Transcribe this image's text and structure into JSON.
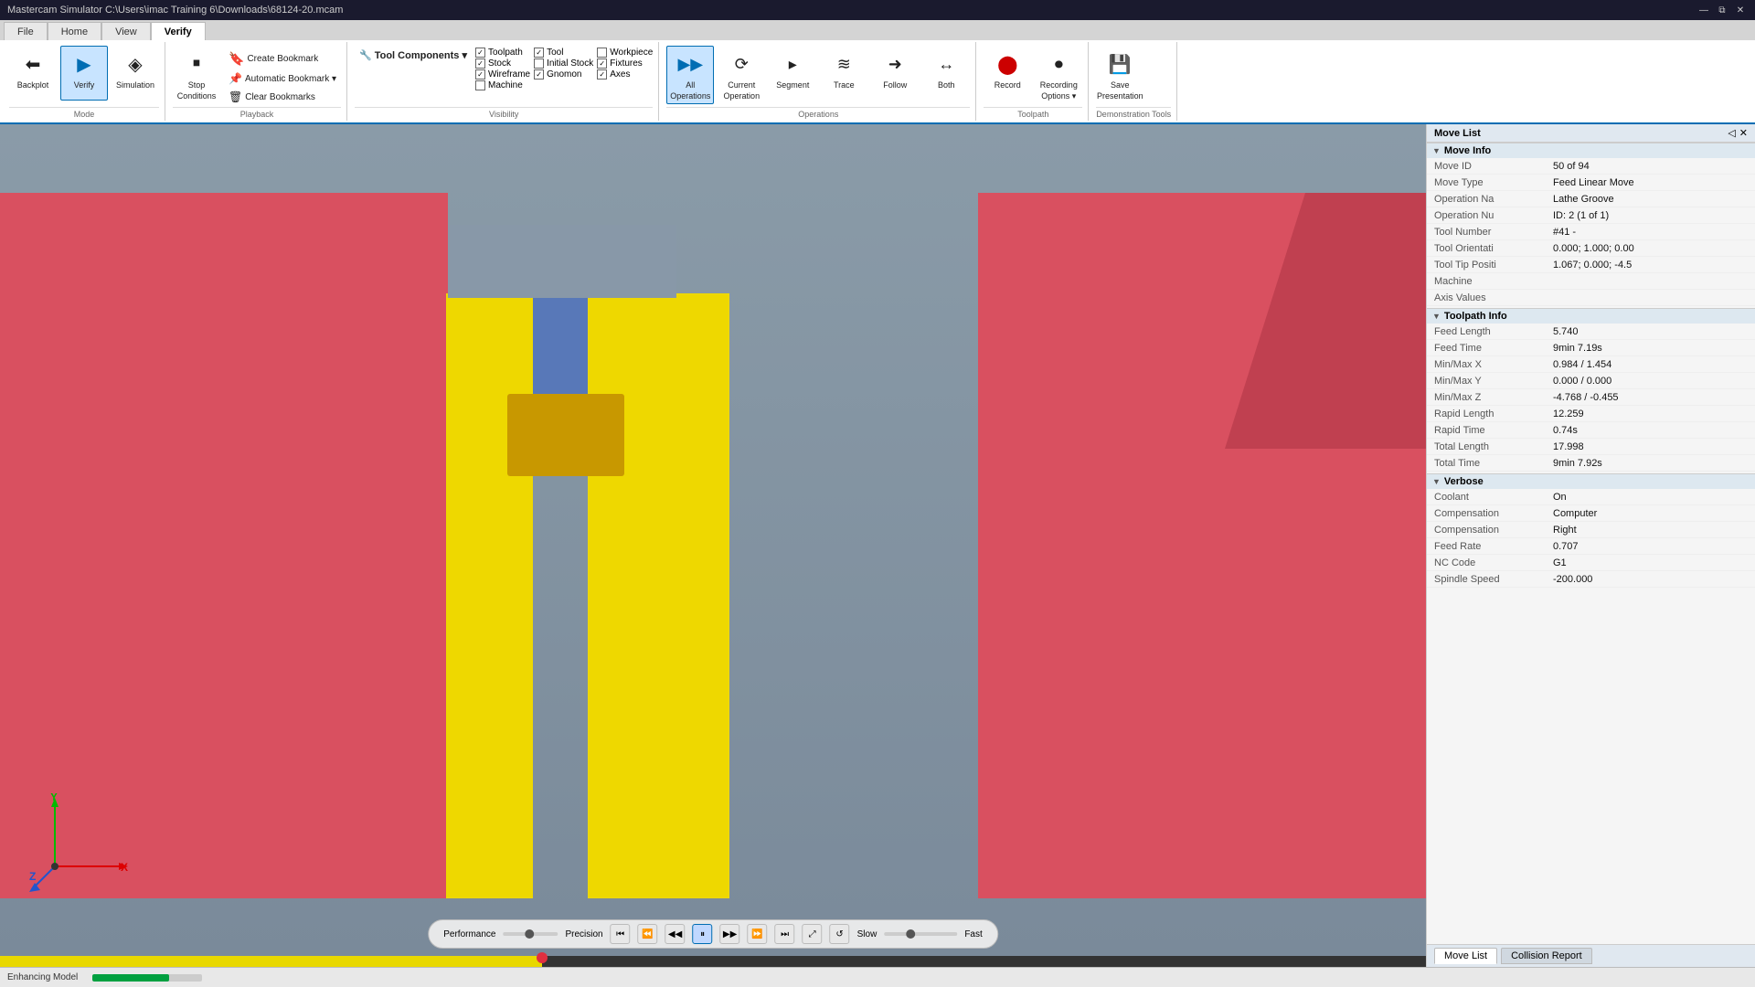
{
  "window": {
    "title": "Mastercam Simulator  C:\\Users\\imac Training 6\\Downloads\\68124-20.mcam",
    "controls": [
      "—",
      "⧉",
      "✕"
    ]
  },
  "tabs": [
    {
      "label": "File",
      "active": false
    },
    {
      "label": "Home",
      "active": false
    },
    {
      "label": "View",
      "active": false
    },
    {
      "label": "Verify",
      "active": true
    }
  ],
  "ribbon": {
    "groups": [
      {
        "name": "Mode",
        "buttons": [
          {
            "icon": "⬅",
            "label": "Backplot",
            "active": false
          },
          {
            "icon": "▶",
            "label": "Verify",
            "active": true
          },
          {
            "icon": "◈",
            "label": "Simulation",
            "active": false
          }
        ]
      },
      {
        "name": "Playback",
        "buttons": [
          {
            "icon": "⏹",
            "label": "Stop Conditions",
            "active": false
          }
        ],
        "items": [
          {
            "label": "Create Bookmark"
          },
          {
            "label": "Automatic Bookmark ▾"
          },
          {
            "label": "Clear Bookmarks"
          }
        ]
      },
      {
        "name": "Visibility",
        "checkboxes_col1": [
          {
            "label": "Toolpath",
            "checked": true
          },
          {
            "label": "Stock",
            "checked": true
          },
          {
            "label": "Wireframe",
            "checked": true
          },
          {
            "label": "Machine",
            "checked": false
          }
        ],
        "checkboxes_col2": [
          {
            "label": "Tool",
            "checked": true
          },
          {
            "label": "Initial Stock",
            "checked": false
          },
          {
            "label": "Gnomon",
            "checked": true
          }
        ],
        "checkboxes_col3": [
          {
            "label": "Workpiece",
            "checked": false
          },
          {
            "label": "Fixtures",
            "checked": true
          },
          {
            "label": "Axes",
            "checked": true
          }
        ],
        "tool_components_label": "Tool Components ▾"
      },
      {
        "name": "Operations",
        "buttons": [
          {
            "icon": "▶▶",
            "label": "All Operations",
            "active": true
          },
          {
            "icon": "⟳",
            "label": "Current Operation",
            "active": false
          },
          {
            "icon": "▸",
            "label": "Segment",
            "active": false
          },
          {
            "icon": "≋",
            "label": "Trace",
            "active": false
          },
          {
            "icon": "➜",
            "label": "Follow",
            "active": false
          },
          {
            "icon": "↔",
            "label": "Both",
            "active": false
          }
        ]
      },
      {
        "name": "Toolpath",
        "buttons": [
          {
            "icon": "⬤",
            "label": "Record",
            "active": false
          },
          {
            "icon": "⏺",
            "label": "Recording Options ▾",
            "active": false
          }
        ]
      },
      {
        "name": "Demonstration Tools",
        "buttons": [
          {
            "icon": "💾",
            "label": "Save Presentation",
            "active": false
          }
        ]
      }
    ]
  },
  "move_info": {
    "title": "Move Info",
    "rows": [
      {
        "label": "Move ID",
        "value": "50 of 94"
      },
      {
        "label": "Move Type",
        "value": "Feed Linear Move"
      },
      {
        "label": "Operation Na",
        "value": "Lathe Groove"
      },
      {
        "label": "Operation Nu",
        "value": "ID: 2 (1 of 1)"
      },
      {
        "label": "Tool Number",
        "value": "#41 -"
      },
      {
        "label": "Tool Orientati",
        "value": "0.000; 1.000; 0.00"
      },
      {
        "label": "Tool Tip Positi",
        "value": "1.067; 0.000; -4.5"
      },
      {
        "label": "Machine",
        "value": ""
      },
      {
        "label": "Axis Values",
        "value": ""
      }
    ]
  },
  "toolpath_info": {
    "title": "Toolpath Info",
    "rows": [
      {
        "label": "Feed Length",
        "value": "5.740"
      },
      {
        "label": "Feed Time",
        "value": "9min 7.19s"
      },
      {
        "label": "Min/Max X",
        "value": "0.984 / 1.454"
      },
      {
        "label": "Min/Max Y",
        "value": "0.000 / 0.000"
      },
      {
        "label": "Min/Max Z",
        "value": "-4.768 / -0.455"
      },
      {
        "label": "Rapid Length",
        "value": "12.259"
      },
      {
        "label": "Rapid Time",
        "value": "0.74s"
      },
      {
        "label": "Total Length",
        "value": "17.998"
      },
      {
        "label": "Total Time",
        "value": "9min 7.92s"
      }
    ]
  },
  "verbose": {
    "title": "Verbose",
    "rows": [
      {
        "label": "Coolant",
        "value": "On"
      },
      {
        "label": "Compensation",
        "value": "Computer"
      },
      {
        "label": "Compensation",
        "value": "Right"
      },
      {
        "label": "Feed Rate",
        "value": "0.707"
      },
      {
        "label": "NC Code",
        "value": "G1"
      },
      {
        "label": "Spindle Speed",
        "value": "-200.000"
      }
    ]
  },
  "playback": {
    "performance_label": "Performance",
    "precision_label": "Precision",
    "slow_label": "Slow",
    "fast_label": "Fast",
    "buttons": [
      "⏮",
      "⏪",
      "◀◀",
      "⏸",
      "▶▶",
      "⏩",
      "⏭",
      "⤢",
      "↺"
    ]
  },
  "footer_tabs": [
    {
      "label": "Move List",
      "active": true
    },
    {
      "label": "Collision Report",
      "active": false
    }
  ],
  "statusbar": {
    "text": "Enhancing Model",
    "progress": 70
  },
  "right_panel_title": "Move List",
  "right_panel_controls": [
    "◁",
    "✕"
  ]
}
